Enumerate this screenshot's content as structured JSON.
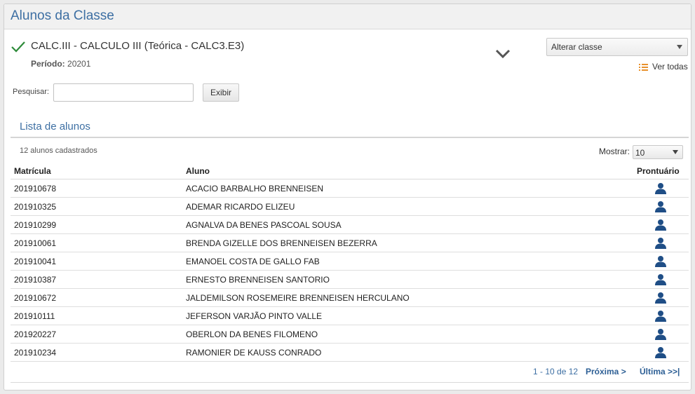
{
  "header": {
    "title": "Alunos da Classe"
  },
  "class_info": {
    "name": "CALC.III - CALCULO III (Teórica - CALC3.E3)",
    "period_label": "Período:",
    "period_value": "20201",
    "change_select_value": "Alterar classe",
    "see_all_label": "Ver todas"
  },
  "search": {
    "label": "Pesquisar:",
    "value": "",
    "button_label": "Exibir"
  },
  "list": {
    "title": "Lista de alunos",
    "count_text": "12 alunos cadastrados",
    "show_label": "Mostrar:",
    "show_value": "10",
    "columns": [
      "Matrícula",
      "Aluno",
      "Prontuário"
    ],
    "rows": [
      {
        "matricula": "201910678",
        "aluno": "ACACIO BARBALHO BRENNEISEN"
      },
      {
        "matricula": "201910325",
        "aluno": "ADEMAR RICARDO ELIZEU"
      },
      {
        "matricula": "201910299",
        "aluno": "AGNALVA DA BENES PASCOAL SOUSA"
      },
      {
        "matricula": "201910061",
        "aluno": "BRENDA GIZELLE DOS BRENNEISEN BEZERRA"
      },
      {
        "matricula": "201910041",
        "aluno": "EMANOEL COSTA DE GALLO FAB"
      },
      {
        "matricula": "201910387",
        "aluno": "ERNESTO BRENNEISEN SANTORIO"
      },
      {
        "matricula": "201910672",
        "aluno": "JALDEMILSON ROSEMEIRE BRENNEISEN HERCULANO"
      },
      {
        "matricula": "201910111",
        "aluno": "JEFERSON VARJÃO PINTO VALLE"
      },
      {
        "matricula": "201920227",
        "aluno": "OBERLON DA BENES FILOMENO"
      },
      {
        "matricula": "201910234",
        "aluno": "RAMONIER DE KAUSS CONRADO"
      }
    ],
    "record_icon": "user-icon"
  },
  "pagination": {
    "range": "1 - 10 de 12",
    "next_label": "Próxima >",
    "last_label": "Última >>|"
  },
  "colors": {
    "accent": "#3d6fa3",
    "check": "#2e8b3a",
    "user_icon": "#1f4e86"
  }
}
